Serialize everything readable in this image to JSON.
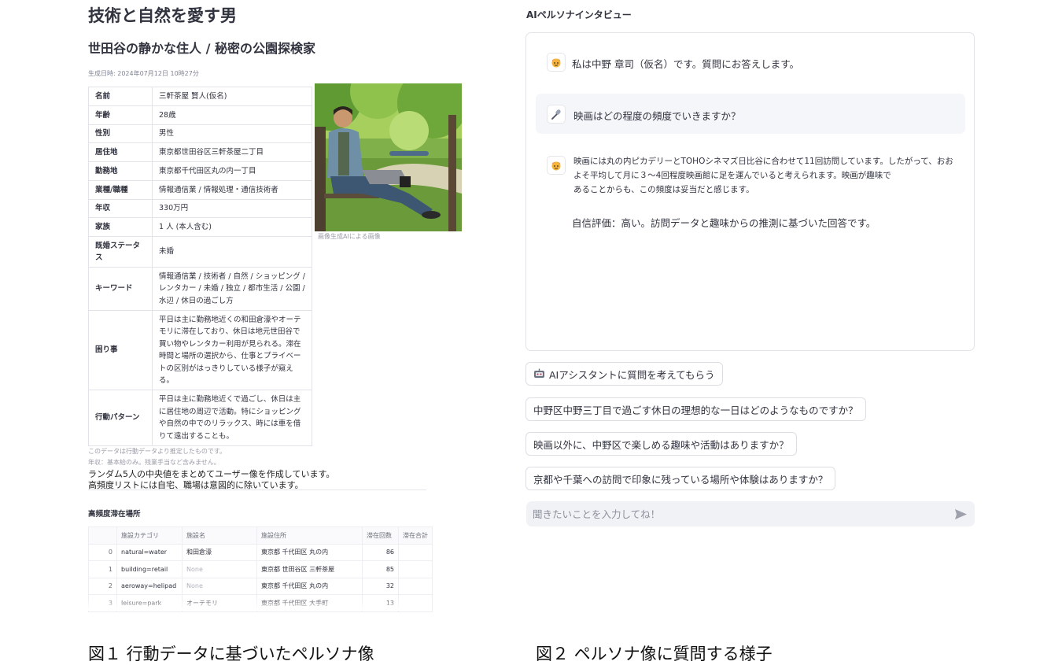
{
  "persona": {
    "title": "技術と自然を愛す男",
    "subtitle": "世田谷の静かな住人 / 秘密の公園探検家",
    "generated_at": "生成日時: 2024年07月12日 10時27分",
    "profile": [
      {
        "key": "名前",
        "value": "三軒茶屋 賢人(仮名)"
      },
      {
        "key": "年齢",
        "value": "28歳"
      },
      {
        "key": "性別",
        "value": "男性"
      },
      {
        "key": "居住地",
        "value": "東京都世田谷区三軒茶屋二丁目"
      },
      {
        "key": "勤務地",
        "value": "東京都千代田区丸の内一丁目"
      },
      {
        "key": "業種/職種",
        "value": "情報通信業 / 情報処理・通信技術者"
      },
      {
        "key": "年収",
        "value": "330万円"
      },
      {
        "key": "家族",
        "value": "1 人 (本人含む)"
      },
      {
        "key": "既婚ステータス",
        "value": "未婚"
      },
      {
        "key": "キーワード",
        "value": "情報通信業 / 技術者 / 自然 / ショッピング / レンタカー / 未婚 / 独立 / 都市生活 / 公園 / 水辺 / 休日の過ごし方"
      },
      {
        "key": "困り事",
        "value": "平日は主に勤務地近くの和田倉濠やオーテモリに滞在しており、休日は地元世田谷で買い物やレンタカー利用が見られる。滞在時間と場所の選択から、仕事とプライベートの区別がはっきりしている様子が窺える。"
      },
      {
        "key": "行動パターン",
        "value": "平日は主に勤務地近くで過ごし、休日は主に居住地の周辺で活動。特にショッピングや自然の中でのリラックス、時には車を借りて遠出することも。"
      }
    ],
    "image_caption": "画像生成AIによる画像",
    "note1": "このデータは行動データより推定したものです。",
    "note2": "年収：基本給のみ。残業手当など含みません。",
    "desc1": "ランダム5人の中央値をまとめてユーザー像を作成しています。",
    "desc2": "高頻度リストには自宅、職場は意図的に除いています。",
    "freq_heading": "高頻度滞在場所",
    "freq_columns": [
      "",
      "施設カテゴリ",
      "施設名",
      "施設住所",
      "滞在回数",
      "滞在合計"
    ],
    "freq_rows": [
      {
        "idx": "0",
        "category": "natural=water",
        "name": "和田倉濠",
        "address": "東京都 千代田区 丸の内",
        "count": "86",
        "total": ""
      },
      {
        "idx": "1",
        "category": "building=retail",
        "name": "None",
        "address": "東京都 世田谷区 三軒茶屋",
        "count": "85",
        "total": ""
      },
      {
        "idx": "2",
        "category": "aeroway=helipad",
        "name": "None",
        "address": "東京都 千代田区 丸の内",
        "count": "32",
        "total": ""
      },
      {
        "idx": "3",
        "category": "leisure=park",
        "name": "オーテモリ",
        "address": "東京都 千代田区 大手町",
        "count": "13",
        "total": ""
      }
    ],
    "figure_caption": "図１ 行動データに基づいたペルソナ像"
  },
  "interview": {
    "heading": "AIペルソナインタビュー",
    "intro": "私は中野 章司（仮名）です。質問にお答えします。",
    "question": "映画はどの程度の頻度でいきますか？",
    "answer_lines": [
      "映画には丸の内ピカデリーとTOHOシネマズ日比谷に合わせて11回訪問しています。したがって、おお",
      "よそ平均して月に３〜4回程度映画館に足を運んでいると考えられます。映画が趣味で",
      "あることからも、この頻度は妥当だと感じます。"
    ],
    "confidence": "自信評価：高い。訪問データと趣味からの推測に基づいた回答です。",
    "assist_button": "AIアシスタントに質問を考えてもらう",
    "suggestions": [
      "中野区中野三丁目で過ごす休日の理想的な一日はどのようなものですか？",
      "映画以外に、中野区で楽しめる趣味や活動はありますか？",
      "京都や千葉への訪問で印象に残っている場所や体験はありますか？"
    ],
    "input_placeholder": "聞きたいことを入力してね！",
    "figure_caption": "図２ ペルソナ像に質問する様子"
  },
  "colors": {
    "text": "#31333f",
    "muted": "#9a9ca8",
    "border": "#e1e3e8",
    "input_bg": "#f0f2f6",
    "send": "#9ea1ab"
  },
  "icons": {
    "persona_avatar": "person-avatar-icon",
    "user_avatar": "microphone-icon",
    "assist": "robot-icon",
    "send": "send-icon"
  }
}
